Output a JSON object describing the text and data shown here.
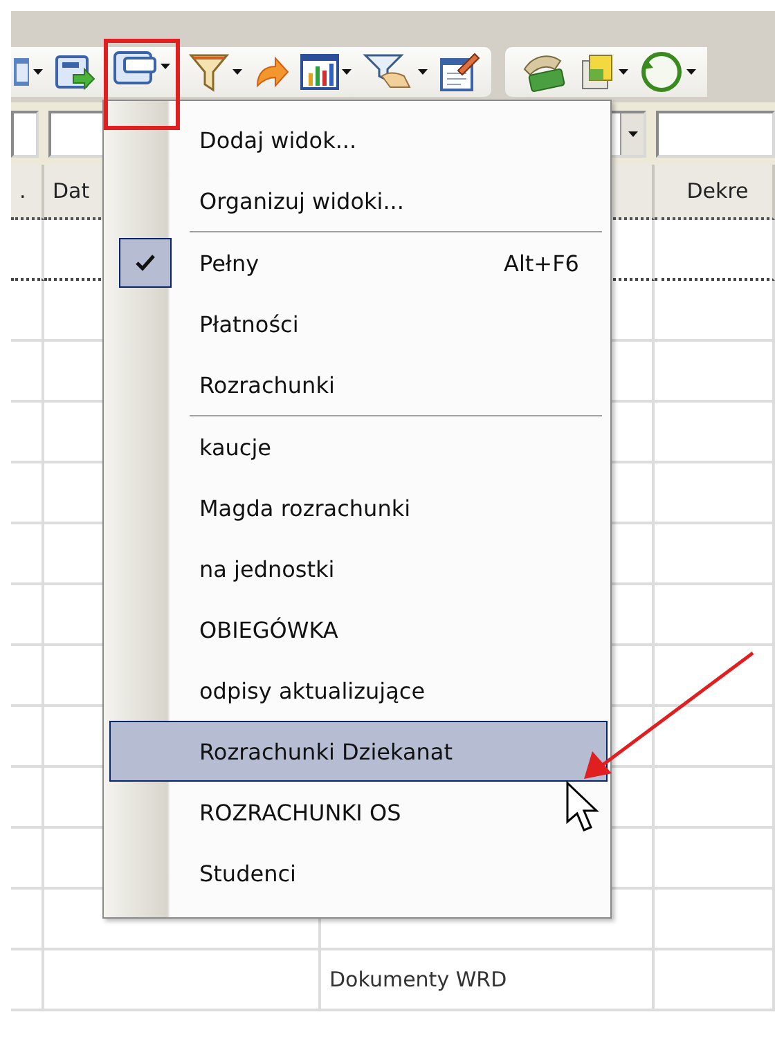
{
  "toolbar": {
    "groups": [
      {
        "buttons": [
          {
            "kind": "grid",
            "dropdown": true,
            "highlighted": false
          },
          {
            "kind": "export",
            "dropdown": false,
            "highlighted": false
          },
          {
            "kind": "views",
            "dropdown": true,
            "highlighted": true
          },
          {
            "kind": "filter",
            "dropdown": true,
            "highlighted": false
          },
          {
            "kind": "redo",
            "dropdown": false,
            "highlighted": false
          },
          {
            "kind": "chart",
            "dropdown": true,
            "highlighted": false
          },
          {
            "kind": "filterhand",
            "dropdown": true,
            "highlighted": false
          },
          {
            "kind": "edit",
            "dropdown": false,
            "highlighted": false
          }
        ]
      },
      {
        "buttons": [
          {
            "kind": "money",
            "dropdown": false,
            "highlighted": false
          },
          {
            "kind": "docs",
            "dropdown": true,
            "highlighted": false
          },
          {
            "kind": "circle",
            "dropdown": true,
            "highlighted": false
          }
        ]
      }
    ]
  },
  "filter_fields": [
    {
      "dropdown": false
    },
    {
      "dropdown": true
    },
    {
      "dropdown": false
    }
  ],
  "table": {
    "columns": [
      {
        "label": "."
      },
      {
        "label": "Dat"
      },
      {},
      {
        "label": "Dekre"
      }
    ],
    "rows": [
      {
        "focused": true
      },
      {
        "focused": false
      },
      {
        "focused": false
      },
      {
        "focused": false
      },
      {
        "focused": false
      },
      {
        "focused": false
      },
      {
        "focused": false
      },
      {
        "focused": false
      },
      {
        "focused": false
      },
      {
        "focused": false
      },
      {
        "focused": false
      },
      {
        "focused": false
      },
      {
        "focused": false,
        "column_3": "Dokumenty WRD"
      }
    ]
  },
  "menu": {
    "items": [
      {
        "kind": "item",
        "label": "Dodaj widok...",
        "checked": false,
        "selected": false
      },
      {
        "kind": "item",
        "label": "Organizuj widoki...",
        "checked": false,
        "selected": false
      },
      {
        "kind": "separator"
      },
      {
        "kind": "item",
        "label": "Pełny",
        "shortcut": "Alt+F6",
        "checked": true,
        "selected": false
      },
      {
        "kind": "item",
        "label": "Płatności",
        "checked": false,
        "selected": false
      },
      {
        "kind": "item",
        "label": "Rozrachunki",
        "checked": false,
        "selected": false
      },
      {
        "kind": "separator"
      },
      {
        "kind": "item",
        "label": "kaucje",
        "checked": false,
        "selected": false
      },
      {
        "kind": "item",
        "label": "Magda rozrachunki",
        "checked": false,
        "selected": false
      },
      {
        "kind": "item",
        "label": "na jednostki",
        "checked": false,
        "selected": false
      },
      {
        "kind": "item",
        "label": "OBIEGÓWKA",
        "checked": false,
        "selected": false
      },
      {
        "kind": "item",
        "label": "odpisy aktualizujące",
        "checked": false,
        "selected": false
      },
      {
        "kind": "item",
        "label": "Rozrachunki Dziekanat",
        "checked": false,
        "selected": true
      },
      {
        "kind": "item",
        "label": "ROZRACHUNKI OS",
        "checked": false,
        "selected": false
      },
      {
        "kind": "item",
        "label": "Studenci",
        "checked": false,
        "selected": false
      }
    ]
  }
}
